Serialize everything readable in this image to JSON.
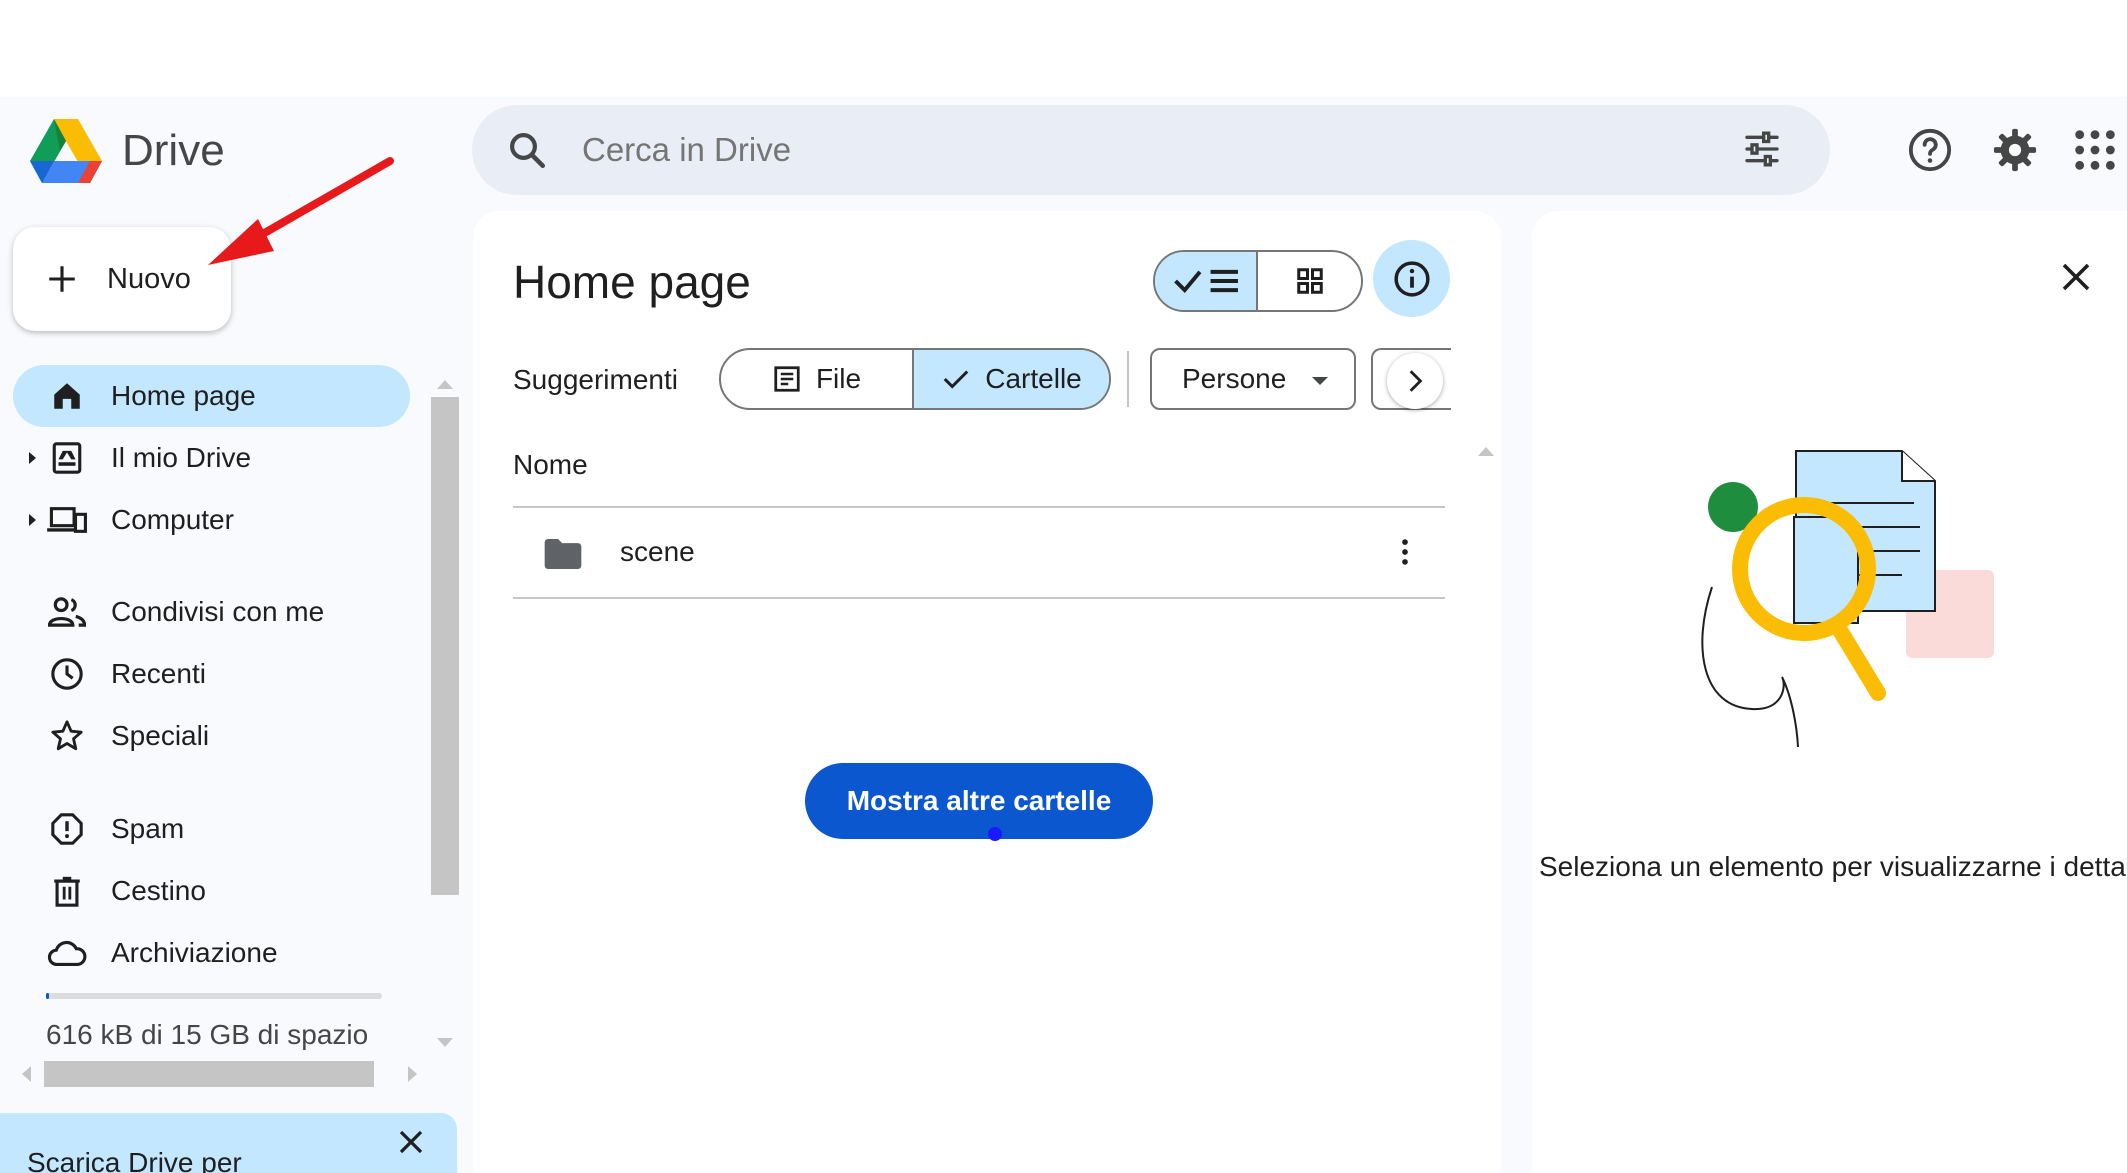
{
  "app": {
    "name": "Drive"
  },
  "header": {
    "search_placeholder": "Cerca in Drive",
    "icons": [
      "search-icon",
      "tune-icon",
      "help-icon",
      "settings-icon",
      "apps-grid-icon"
    ]
  },
  "new_button": {
    "label": "Nuovo"
  },
  "sidebar": {
    "items": [
      {
        "label": "Home page",
        "icon": "home-icon",
        "active": true
      },
      {
        "label": "Il mio Drive",
        "icon": "my-drive-icon",
        "expandable": true
      },
      {
        "label": "Computer",
        "icon": "computer-icon",
        "expandable": true
      },
      {
        "label": "Condivisi con me",
        "icon": "shared-people-icon"
      },
      {
        "label": "Recenti",
        "icon": "clock-icon"
      },
      {
        "label": "Speciali",
        "icon": "star-icon"
      },
      {
        "label": "Spam",
        "icon": "spam-icon"
      },
      {
        "label": "Cestino",
        "icon": "trash-icon"
      },
      {
        "label": "Archiviazione",
        "icon": "cloud-icon"
      }
    ],
    "storage_text": "616 kB di 15 GB di spazio",
    "promo_text": "Scarica Drive per"
  },
  "main": {
    "title": "Home page",
    "suggestions_label": "Suggerimenti",
    "chips": {
      "file": "File",
      "folders": "Cartelle",
      "people": "Persone"
    },
    "column_header": "Nome",
    "rows": [
      {
        "name": "scene",
        "icon": "folder-icon"
      }
    ],
    "show_more_label": "Mostra altre cartelle"
  },
  "details": {
    "message": "Seleziona un elemento per visualizzarne i dettag"
  },
  "colors": {
    "accent": "#0b57d0",
    "selected": "#c2e7ff",
    "surface": "#f8fafd",
    "annotation_arrow": "#e8191b"
  }
}
